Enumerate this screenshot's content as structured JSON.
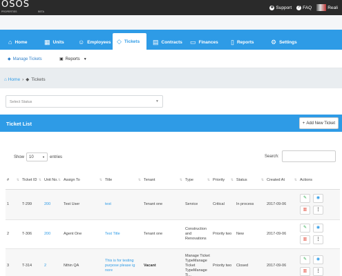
{
  "header": {
    "logo_text": "OSOS",
    "logo_sub": "PROPERTIES",
    "logo_beta": "BETA",
    "support_label": "Support",
    "faq_label": "FAQ",
    "user_name": "Reali"
  },
  "nav": {
    "items": [
      {
        "label": "Home",
        "icon": "home-icon"
      },
      {
        "label": "Units",
        "icon": "building-icon"
      },
      {
        "label": "Employees",
        "icon": "users-icon"
      },
      {
        "label": "Tickets",
        "icon": "tag-icon",
        "active": true
      },
      {
        "label": "Contracts",
        "icon": "clipboard-icon"
      },
      {
        "label": "Finances",
        "icon": "money-icon"
      },
      {
        "label": "Reports",
        "icon": "document-icon"
      },
      {
        "label": "Settings",
        "icon": "gear-icon"
      }
    ]
  },
  "subnav": {
    "manage_tickets": "Manage Tickets",
    "reports": "Reports"
  },
  "breadcrumb": {
    "home": "Home",
    "current": "Tickets"
  },
  "filters": {
    "status_placeholder": "Select Status"
  },
  "list": {
    "title": "Ticket List",
    "add_button": "Add New Ticket",
    "show_label": "Show",
    "entries_value": "10",
    "entries_label": "entries",
    "search_label": "Search:",
    "columns": [
      "#",
      "Ticket ID",
      "Unit No.",
      "Assign To",
      "Title",
      "Tenant",
      "Type",
      "Priority",
      "Status",
      "Created At",
      "Actions"
    ],
    "rows": [
      {
        "num": "1",
        "ticket_id": "T-299",
        "unit": "200",
        "assign": "Test User",
        "title": "test",
        "tenant": "Tenant one",
        "type": "Service",
        "priority": "Critical",
        "status": "In process",
        "created": "2017-09-06"
      },
      {
        "num": "2",
        "ticket_id": "T-306",
        "unit": "200",
        "assign": "Agent One",
        "title": "Test Title",
        "tenant": "Tenant one",
        "type": "Construction and Renovations",
        "priority": "Priority two",
        "status": "New",
        "created": "2017-09-06"
      },
      {
        "num": "3",
        "ticket_id": "T-314",
        "unit": "2",
        "assign": "Nthin QA",
        "title": "This is for testing purpose please ig nore",
        "tenant": "Vacant",
        "type": "Manage Ticket TypeManage Ticket TypeManage Ti...",
        "priority": "Priority two",
        "status": "Closed",
        "created": "2017-09-06"
      }
    ]
  },
  "colors": {
    "accent": "#2e9be6",
    "topbar": "#2a2a2a",
    "edit": "#2aa84a",
    "delete": "#e0412f"
  }
}
